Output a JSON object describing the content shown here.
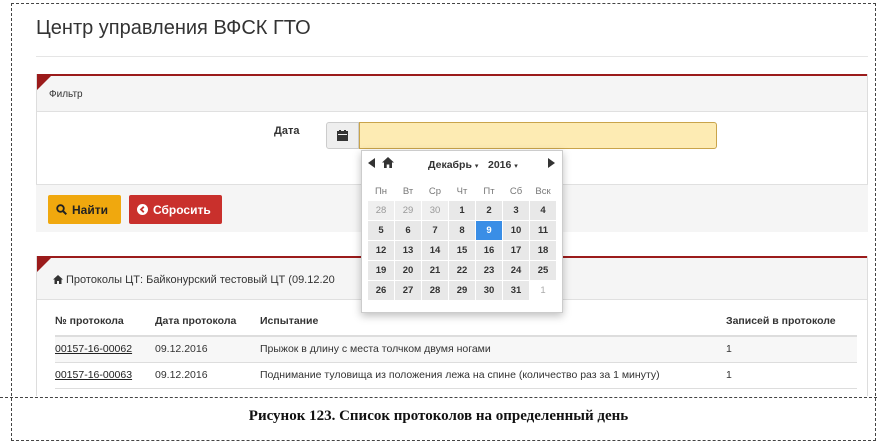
{
  "app": {
    "title": "Центр управления ВФСК ГТО"
  },
  "filter": {
    "header": "Фильтр",
    "date_label": "Дата",
    "date_value": "",
    "find_label": "Найти",
    "reset_label": "Сбросить"
  },
  "calendar": {
    "month": "Декабрь",
    "year": "2016",
    "weekdays": [
      "Пн",
      "Вт",
      "Ср",
      "Чт",
      "Пт",
      "Сб",
      "Вск"
    ],
    "weeks": [
      [
        "28",
        "29",
        "30",
        "1",
        "2",
        "3",
        "4"
      ],
      [
        "5",
        "6",
        "7",
        "8",
        "9",
        "10",
        "11"
      ],
      [
        "12",
        "13",
        "14",
        "15",
        "16",
        "17",
        "18"
      ],
      [
        "19",
        "20",
        "21",
        "22",
        "23",
        "24",
        "25"
      ],
      [
        "26",
        "27",
        "28",
        "29",
        "30",
        "31",
        "1"
      ]
    ],
    "selected": "9"
  },
  "protocols": {
    "title": "Протоколы ЦТ: Байконурский тестовый ЦТ (09.12.20",
    "columns": [
      "№ протокола",
      "Дата протокола",
      "Испытание",
      "Записей в протоколе"
    ],
    "rows": [
      [
        "00157-16-00062",
        "09.12.2016",
        "Прыжок в длину с места толчком двумя ногами",
        "1"
      ],
      [
        "00157-16-00063",
        "09.12.2016",
        "Поднимание туловища из положения лежа на спине (количество раз за 1 минуту)",
        "1"
      ]
    ]
  },
  "caption": "Рисунок 123. Список протоколов на определенный день",
  "colors": {
    "accent": "#9b1b1b",
    "find_button": "#f0a80e",
    "reset_button": "#c9302c",
    "date_input": "#fdebb3",
    "selected_day": "#3a8ee6"
  },
  "icons": {
    "calendar": "calendar-icon",
    "search": "search-icon",
    "reset": "reset-icon",
    "home": "home-icon"
  }
}
